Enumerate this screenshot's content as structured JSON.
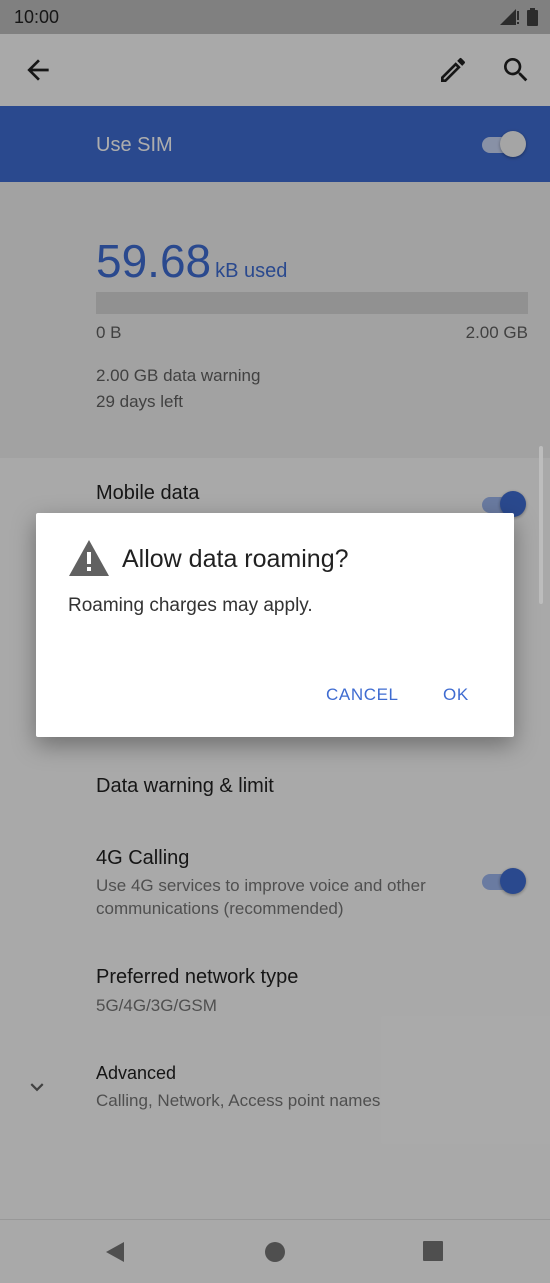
{
  "status_bar": {
    "time": "10:00",
    "icons": [
      "signal-icon",
      "battery-icon"
    ]
  },
  "app_bar": {
    "icons": [
      "back-arrow-icon",
      "edit-pencil-icon",
      "search-icon"
    ]
  },
  "sim": {
    "label": "Use SIM",
    "enabled": true
  },
  "usage": {
    "amount": "59.68",
    "unit": "kB used",
    "progress_fraction": 0.0,
    "min_label": "0 B",
    "max_label": "2.00 GB",
    "warning": "2.00 GB data warning",
    "days_left": "29 days left"
  },
  "settings": {
    "mobile_data": {
      "title": "Mobile data",
      "enabled": true
    },
    "data_warning": {
      "title": "Data warning & limit"
    },
    "calling_4g": {
      "title": "4G Calling",
      "subtitle": "Use 4G services to improve voice and other communications (recommended)",
      "enabled": true
    },
    "network_type": {
      "title": "Preferred network type",
      "subtitle": "5G/4G/3G/GSM"
    },
    "advanced": {
      "title": "Advanced",
      "subtitle": "Calling, Network, Access point names"
    }
  },
  "dialog": {
    "title": "Allow data roaming?",
    "message": "Roaming charges may apply.",
    "cancel_label": "CANCEL",
    "ok_label": "OK"
  },
  "nav_bar": {
    "icons": [
      "back-triangle-icon",
      "home-circle-icon",
      "recents-square-icon"
    ]
  },
  "colors": {
    "accent": "#3f6cd1",
    "scrim": "#000000"
  }
}
